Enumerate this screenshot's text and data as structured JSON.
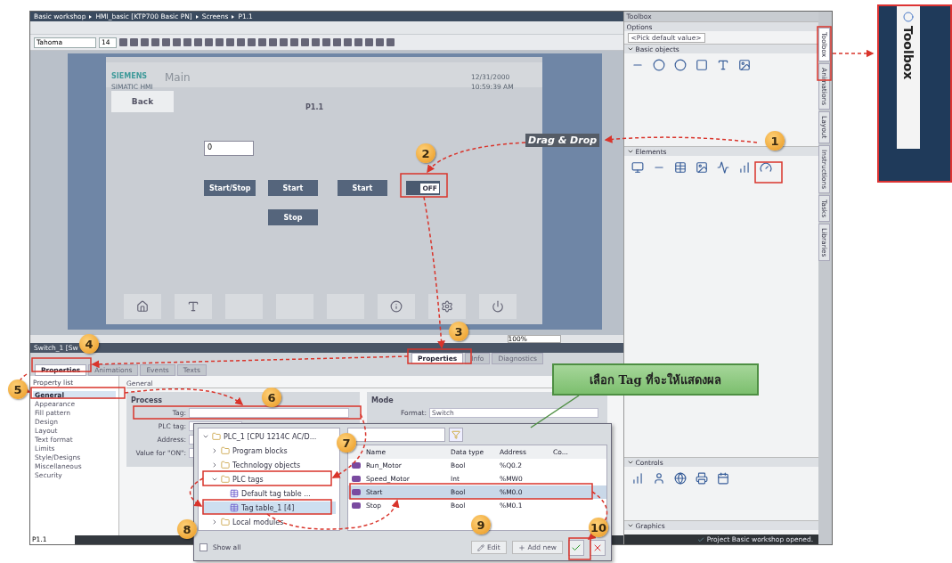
{
  "breadcrumb": [
    "Basic workshop",
    "HMI_basic [KTP700 Basic PN]",
    "Screens",
    "P1.1"
  ],
  "toolbar": {
    "font": "Tahoma",
    "size": "14"
  },
  "hmi_screen": {
    "brand": "SIEMENS",
    "brand_sub": "SIMATIC HMI",
    "title": "Main",
    "date": "12/31/2000",
    "time": "10:59:39 AM",
    "back_button": "Back",
    "screen_name": "P1.1",
    "io_field": "0",
    "buttons": [
      {
        "label": "Start/Stop"
      },
      {
        "label": "Start"
      },
      {
        "label": "Start"
      },
      {
        "label": "Stop"
      }
    ],
    "switch": {
      "label": "OFF"
    },
    "zoom": "100%"
  },
  "inspector": {
    "title": "Switch_1 [Sw",
    "tabs": [
      {
        "label": "Properties",
        "selected": true
      },
      {
        "label": "Info",
        "selected": false
      },
      {
        "label": "Diagnostics",
        "selected": false
      }
    ],
    "subtabs": [
      {
        "label": "Properties",
        "selected": true
      },
      {
        "label": "Animations",
        "selected": false
      },
      {
        "label": "Events",
        "selected": false
      },
      {
        "label": "Texts",
        "selected": false
      }
    ],
    "property_list_title": "Property list",
    "property_list": [
      {
        "label": "General",
        "selected": true
      },
      {
        "label": "Appearance",
        "selected": false
      },
      {
        "label": "Fill pattern",
        "selected": false
      },
      {
        "label": "Design",
        "selected": false
      },
      {
        "label": "Layout",
        "selected": false
      },
      {
        "label": "Text format",
        "selected": false
      },
      {
        "label": "Limits",
        "selected": false
      },
      {
        "label": "Style/Designs",
        "selected": false
      },
      {
        "label": "Miscellaneous",
        "selected": false
      },
      {
        "label": "Security",
        "selected": false
      }
    ],
    "section": "General",
    "process_title": "Process",
    "process_fields": [
      {
        "label": "Tag:"
      },
      {
        "label": "PLC tag:"
      },
      {
        "label": "Address:"
      },
      {
        "label": "Value for \"ON\":"
      }
    ],
    "mode_title": "Mode",
    "format_label": "Format:",
    "format_value": "Switch"
  },
  "tag_dialog": {
    "tree": [
      {
        "label": "PLC_1 [CPU 1214C AC/D...",
        "expanded": true,
        "selected": false,
        "children": [
          {
            "label": "Program blocks",
            "expanded": false,
            "selected": false
          },
          {
            "label": "Technology objects",
            "expanded": false,
            "selected": false
          },
          {
            "label": "PLC tags",
            "expanded": true,
            "selected": false,
            "children": [
              {
                "label": "Default tag table ...",
                "selected": false
              },
              {
                "label": "Tag table_1 [4]",
                "selected": true
              }
            ]
          },
          {
            "label": "Local modules",
            "expanded": false,
            "selected": false
          }
        ]
      }
    ],
    "columns": [
      "Name",
      "Data type",
      "Address",
      "Co..."
    ],
    "rows": [
      {
        "name": "Run_Motor",
        "type": "Bool",
        "address": "%Q0.2",
        "selected": false
      },
      {
        "name": "Speed_Motor",
        "type": "Int",
        "address": "%MW0",
        "selected": false
      },
      {
        "name": "Start",
        "type": "Bool",
        "address": "%M0.0",
        "selected": true
      },
      {
        "name": "Stop",
        "type": "Bool",
        "address": "%M0.1",
        "selected": false
      }
    ],
    "show_all": {
      "label": "Show all",
      "checked": false
    },
    "buttons": [
      {
        "label": "Edit"
      },
      {
        "label": "Add new"
      }
    ]
  },
  "toolbox": {
    "title": "Toolbox",
    "options": "Options",
    "default_value": "<Pick default value>",
    "sections": [
      {
        "title": "Basic objects",
        "expanded": true
      },
      {
        "title": "Elements",
        "expanded": true
      },
      {
        "title": "Controls",
        "expanded": true
      },
      {
        "title": "Graphics",
        "expanded": true
      }
    ],
    "side_tabs": [
      {
        "label": "Toolbox",
        "selected": true
      },
      {
        "label": "Animations",
        "selected": false
      },
      {
        "label": "Layout",
        "selected": false
      },
      {
        "label": "Instructions",
        "selected": false
      },
      {
        "label": "Tasks",
        "selected": false
      },
      {
        "label": "Libraries",
        "selected": false
      }
    ]
  },
  "status": "Project Basic workshop opened.",
  "bottom_field": "P1.1",
  "annotations": {
    "drag_label": "Drag & Drop",
    "callout": "เลือก Tag ที่จะให้แสดงผล",
    "inset_label": "Toolbox",
    "badges": [
      "1",
      "2",
      "3",
      "4",
      "5",
      "6",
      "7",
      "8",
      "9",
      "10"
    ]
  }
}
